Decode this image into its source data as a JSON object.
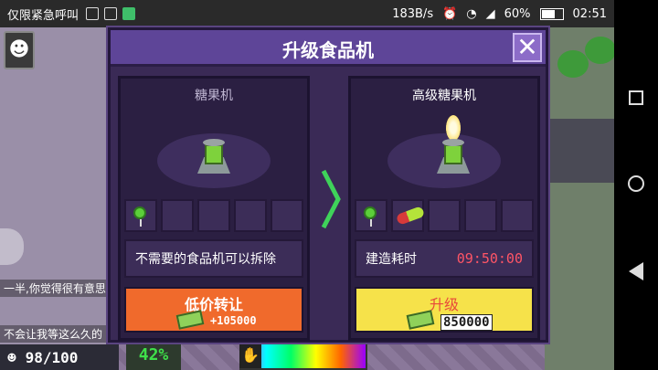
{
  "status_bar": {
    "carrier": "仅限紧急呼叫",
    "speed": "183B/s",
    "battery": "60%",
    "time": "02:51"
  },
  "dialog": {
    "title": "升级食品机",
    "close_icon": "close-x-icon",
    "current": {
      "name": "糖果机",
      "description": "不需要的食品机可以拆除",
      "sell_label": "低价转让",
      "sell_amount": "+105000"
    },
    "upgrade": {
      "name": "高级糖果机",
      "build_time_label": "建造耗时",
      "build_time": "09:50:00",
      "upgrade_label": "升级",
      "cost": "850000"
    }
  },
  "hud": {
    "population": "98/100",
    "percent": "42%"
  },
  "chat": {
    "line1": "一半,你觉得很有意思",
    "line2": "不会让我等这么久的"
  },
  "colors": {
    "dialog_bg": "#3a2a56",
    "header_bg": "#5e4598",
    "sell_button": "#f06a2c",
    "upgrade_button": "#f6e24a",
    "time_red": "#ff5566"
  }
}
